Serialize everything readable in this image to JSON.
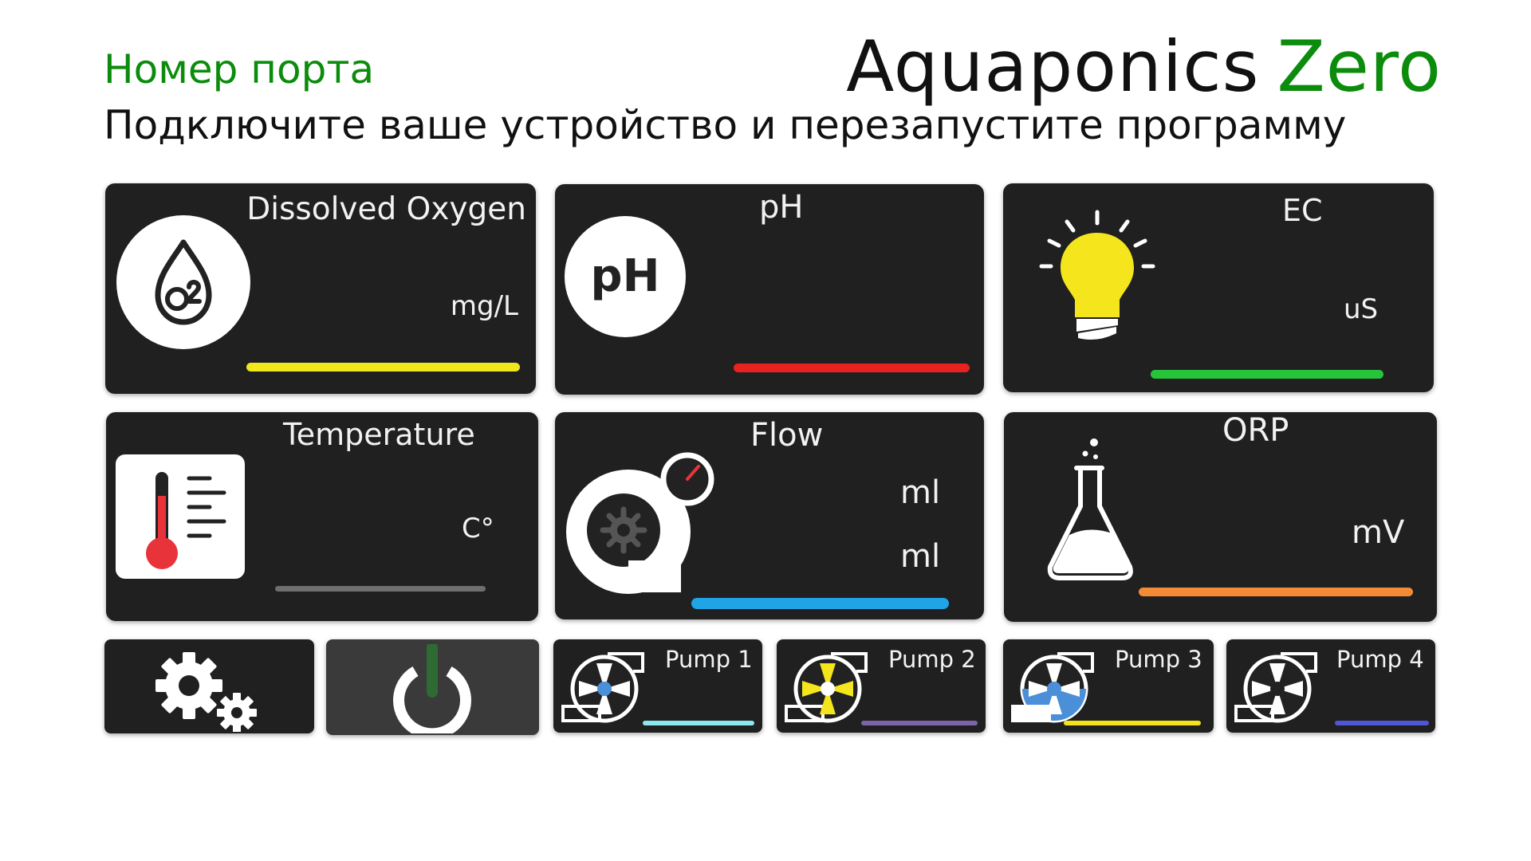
{
  "header": {
    "port_label": "Номер порта",
    "brand_main": "Aquaponics",
    "brand_accent": "Zero",
    "subtitle": "Подключите ваше устройство и перезапустите программу"
  },
  "sensors": {
    "dissolved_oxygen": {
      "title": "Dissolved Oxygen",
      "unit": "mg/L",
      "icon": "o2-drop-icon",
      "bar_color": "#f0e81a"
    },
    "ph": {
      "title": "pH",
      "icon_text": "pH",
      "icon": "ph-icon",
      "bar_color": "#e8231f"
    },
    "ec": {
      "title": "EC",
      "unit": "uS",
      "icon": "light-bulb-icon",
      "bar_color": "#27c43b"
    },
    "temperature": {
      "title": "Temperature",
      "unit": "C°",
      "icon": "thermometer-icon",
      "bar_color": "#6e6e6e"
    },
    "flow": {
      "title": "Flow",
      "unit_1": "ml",
      "unit_2": "ml",
      "icon": "flow-meter-icon",
      "bar_color": "#20a4e8"
    },
    "orp": {
      "title": "ORP",
      "unit": "mV",
      "icon": "flask-icon",
      "bar_color": "#f38a35"
    }
  },
  "controls": {
    "settings_icon": "gears-icon",
    "power_icon": "power-icon"
  },
  "pumps": [
    {
      "label": "Pump 1",
      "icon": "pump-icon",
      "bar_color": "#8ae8ee"
    },
    {
      "label": "Pump 2",
      "icon": "pump-icon",
      "bar_color": "#7e63a8"
    },
    {
      "label": "Pump 3",
      "icon": "pump-icon",
      "bar_color": "#f4e21a"
    },
    {
      "label": "Pump 4",
      "icon": "pump-icon",
      "bar_color": "#4f56d8"
    }
  ]
}
